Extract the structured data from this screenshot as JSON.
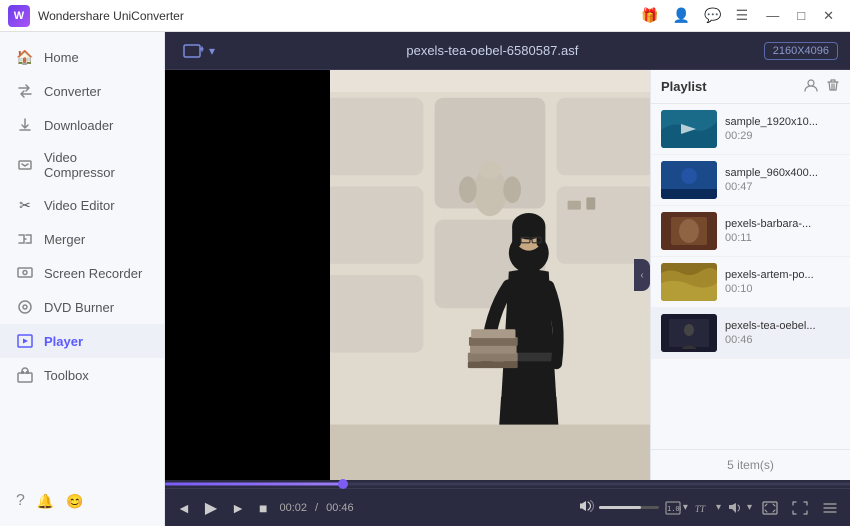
{
  "app": {
    "title": "Wondershare UniConverter",
    "logo_text": "W"
  },
  "titlebar": {
    "title": "Wondershare UniConverter",
    "controls": [
      "−",
      "□",
      "✕"
    ]
  },
  "titlebar_icons": [
    "🎁",
    "👤",
    "💬"
  ],
  "sidebar": {
    "items": [
      {
        "id": "home",
        "label": "Home",
        "icon": "🏠"
      },
      {
        "id": "converter",
        "label": "Converter",
        "icon": "↔"
      },
      {
        "id": "downloader",
        "label": "Downloader",
        "icon": "↓"
      },
      {
        "id": "video-compressor",
        "label": "Video Compressor",
        "icon": "📦"
      },
      {
        "id": "video-editor",
        "label": "Video Editor",
        "icon": "✂"
      },
      {
        "id": "merger",
        "label": "Merger",
        "icon": "🔗"
      },
      {
        "id": "screen-recorder",
        "label": "Screen Recorder",
        "icon": "📷"
      },
      {
        "id": "dvd-burner",
        "label": "DVD Burner",
        "icon": "💿"
      },
      {
        "id": "player",
        "label": "Player",
        "icon": "▶"
      },
      {
        "id": "toolbox",
        "label": "Toolbox",
        "icon": "🧰"
      }
    ],
    "bottom_icons": [
      "?",
      "🔔",
      "😊"
    ]
  },
  "topbar": {
    "add_btn_label": "＋",
    "file_name": "pexels-tea-oebel-6580587.asf",
    "resolution": "2160X4096"
  },
  "player": {
    "current_time": "00:02",
    "total_time": "00:46",
    "progress_pct": 26
  },
  "playlist": {
    "title": "Playlist",
    "footer": "5 item(s)",
    "items": [
      {
        "name": "sample_1920x10...",
        "duration": "00:29",
        "thumb_class": "thumb-1"
      },
      {
        "name": "sample_960x400...",
        "duration": "00:47",
        "thumb_class": "thumb-2"
      },
      {
        "name": "pexels-barbara-...",
        "duration": "00:11",
        "thumb_class": "thumb-3"
      },
      {
        "name": "pexels-artem-po...",
        "duration": "00:10",
        "thumb_class": "thumb-4"
      },
      {
        "name": "pexels-tea-oebel...",
        "duration": "00:46",
        "thumb_class": "thumb-5"
      }
    ]
  },
  "controls": {
    "prev": "◄",
    "play": "▶",
    "next": "►",
    "stop": "■",
    "volume_icon": "🔈",
    "speed_label": "1.0×",
    "subtitle_icon": "TT",
    "audio_label": "audio",
    "screen_icon": "⛶",
    "fullscreen_icon": "⤢",
    "menu_icon": "≡"
  }
}
